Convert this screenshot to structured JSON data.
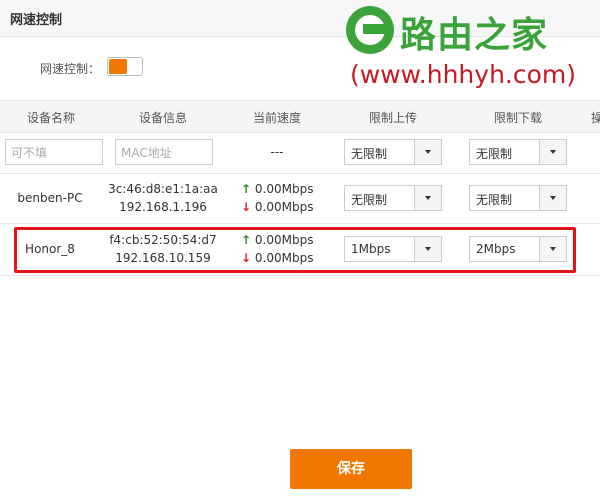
{
  "header": {
    "title": "网速控制"
  },
  "watermark": {
    "brand": "路由之家",
    "url": "(www.hhhyh.com)"
  },
  "speed_control": {
    "label": "网速控制：",
    "enabled": true,
    "accent_color": "#f07800"
  },
  "table": {
    "columns": [
      "设备名称",
      "设备信息",
      "当前速度",
      "限制上传",
      "限制下载",
      "操"
    ],
    "new_row": {
      "name_placeholder": "可不填",
      "mac_placeholder": "MAC地址",
      "speed": "---",
      "upload": "无限制",
      "download": "无限制"
    },
    "rows": [
      {
        "name": "benben-PC",
        "mac": "3c:46:d8:e1:1a:aa",
        "ip": "192.168.1.196",
        "up_speed": "0.00Mbps",
        "down_speed": "0.00Mbps",
        "upload": "无限制",
        "download": "无限制"
      },
      {
        "name": "Honor_8",
        "mac": "f4:cb:52:50:54:d7",
        "ip": "192.168.10.159",
        "up_speed": "0.00Mbps",
        "down_speed": "0.00Mbps",
        "upload": "1Mbps",
        "download": "2Mbps"
      }
    ]
  },
  "footer": {
    "save_label": "保存",
    "button_color": "#f07800"
  },
  "icons": {
    "up": "↑",
    "down": "↓"
  }
}
